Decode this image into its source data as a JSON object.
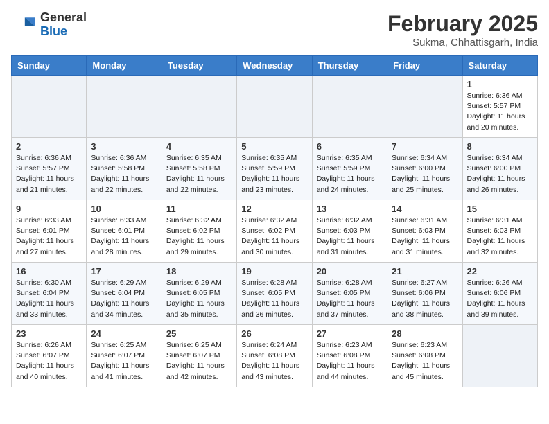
{
  "header": {
    "logo_general": "General",
    "logo_blue": "Blue",
    "month_title": "February 2025",
    "location": "Sukma, Chhattisgarh, India"
  },
  "days_of_week": [
    "Sunday",
    "Monday",
    "Tuesday",
    "Wednesday",
    "Thursday",
    "Friday",
    "Saturday"
  ],
  "weeks": [
    [
      {
        "day": "",
        "info": ""
      },
      {
        "day": "",
        "info": ""
      },
      {
        "day": "",
        "info": ""
      },
      {
        "day": "",
        "info": ""
      },
      {
        "day": "",
        "info": ""
      },
      {
        "day": "",
        "info": ""
      },
      {
        "day": "1",
        "info": "Sunrise: 6:36 AM\nSunset: 5:57 PM\nDaylight: 11 hours\nand 20 minutes."
      }
    ],
    [
      {
        "day": "2",
        "info": "Sunrise: 6:36 AM\nSunset: 5:57 PM\nDaylight: 11 hours\nand 21 minutes."
      },
      {
        "day": "3",
        "info": "Sunrise: 6:36 AM\nSunset: 5:58 PM\nDaylight: 11 hours\nand 22 minutes."
      },
      {
        "day": "4",
        "info": "Sunrise: 6:35 AM\nSunset: 5:58 PM\nDaylight: 11 hours\nand 22 minutes."
      },
      {
        "day": "5",
        "info": "Sunrise: 6:35 AM\nSunset: 5:59 PM\nDaylight: 11 hours\nand 23 minutes."
      },
      {
        "day": "6",
        "info": "Sunrise: 6:35 AM\nSunset: 5:59 PM\nDaylight: 11 hours\nand 24 minutes."
      },
      {
        "day": "7",
        "info": "Sunrise: 6:34 AM\nSunset: 6:00 PM\nDaylight: 11 hours\nand 25 minutes."
      },
      {
        "day": "8",
        "info": "Sunrise: 6:34 AM\nSunset: 6:00 PM\nDaylight: 11 hours\nand 26 minutes."
      }
    ],
    [
      {
        "day": "9",
        "info": "Sunrise: 6:33 AM\nSunset: 6:01 PM\nDaylight: 11 hours\nand 27 minutes."
      },
      {
        "day": "10",
        "info": "Sunrise: 6:33 AM\nSunset: 6:01 PM\nDaylight: 11 hours\nand 28 minutes."
      },
      {
        "day": "11",
        "info": "Sunrise: 6:32 AM\nSunset: 6:02 PM\nDaylight: 11 hours\nand 29 minutes."
      },
      {
        "day": "12",
        "info": "Sunrise: 6:32 AM\nSunset: 6:02 PM\nDaylight: 11 hours\nand 30 minutes."
      },
      {
        "day": "13",
        "info": "Sunrise: 6:32 AM\nSunset: 6:03 PM\nDaylight: 11 hours\nand 31 minutes."
      },
      {
        "day": "14",
        "info": "Sunrise: 6:31 AM\nSunset: 6:03 PM\nDaylight: 11 hours\nand 31 minutes."
      },
      {
        "day": "15",
        "info": "Sunrise: 6:31 AM\nSunset: 6:03 PM\nDaylight: 11 hours\nand 32 minutes."
      }
    ],
    [
      {
        "day": "16",
        "info": "Sunrise: 6:30 AM\nSunset: 6:04 PM\nDaylight: 11 hours\nand 33 minutes."
      },
      {
        "day": "17",
        "info": "Sunrise: 6:29 AM\nSunset: 6:04 PM\nDaylight: 11 hours\nand 34 minutes."
      },
      {
        "day": "18",
        "info": "Sunrise: 6:29 AM\nSunset: 6:05 PM\nDaylight: 11 hours\nand 35 minutes."
      },
      {
        "day": "19",
        "info": "Sunrise: 6:28 AM\nSunset: 6:05 PM\nDaylight: 11 hours\nand 36 minutes."
      },
      {
        "day": "20",
        "info": "Sunrise: 6:28 AM\nSunset: 6:05 PM\nDaylight: 11 hours\nand 37 minutes."
      },
      {
        "day": "21",
        "info": "Sunrise: 6:27 AM\nSunset: 6:06 PM\nDaylight: 11 hours\nand 38 minutes."
      },
      {
        "day": "22",
        "info": "Sunrise: 6:26 AM\nSunset: 6:06 PM\nDaylight: 11 hours\nand 39 minutes."
      }
    ],
    [
      {
        "day": "23",
        "info": "Sunrise: 6:26 AM\nSunset: 6:07 PM\nDaylight: 11 hours\nand 40 minutes."
      },
      {
        "day": "24",
        "info": "Sunrise: 6:25 AM\nSunset: 6:07 PM\nDaylight: 11 hours\nand 41 minutes."
      },
      {
        "day": "25",
        "info": "Sunrise: 6:25 AM\nSunset: 6:07 PM\nDaylight: 11 hours\nand 42 minutes."
      },
      {
        "day": "26",
        "info": "Sunrise: 6:24 AM\nSunset: 6:08 PM\nDaylight: 11 hours\nand 43 minutes."
      },
      {
        "day": "27",
        "info": "Sunrise: 6:23 AM\nSunset: 6:08 PM\nDaylight: 11 hours\nand 44 minutes."
      },
      {
        "day": "28",
        "info": "Sunrise: 6:23 AM\nSunset: 6:08 PM\nDaylight: 11 hours\nand 45 minutes."
      },
      {
        "day": "",
        "info": ""
      }
    ]
  ]
}
